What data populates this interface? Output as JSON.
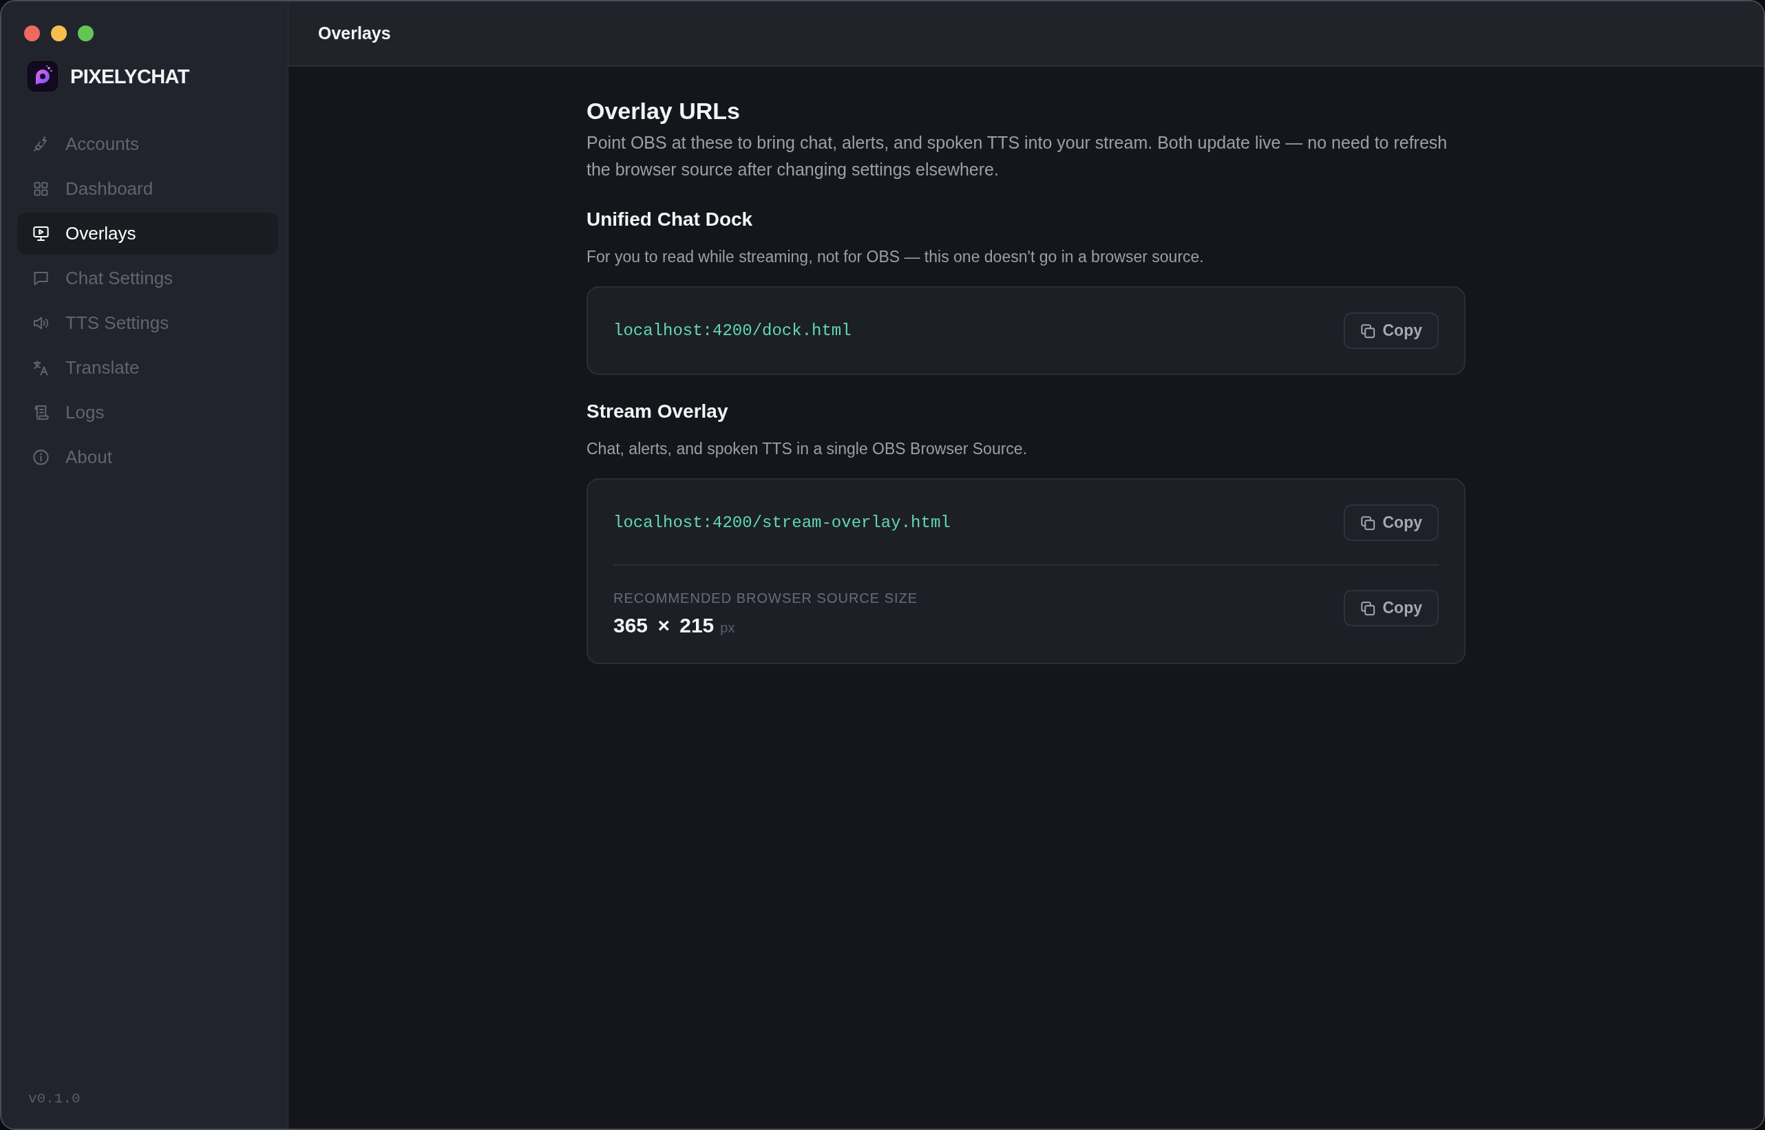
{
  "sidebar": {
    "app_name": "PIXELYCHAT",
    "items": [
      {
        "label": "Accounts",
        "selected": false
      },
      {
        "label": "Dashboard",
        "selected": false
      },
      {
        "label": "Overlays",
        "selected": true
      },
      {
        "label": "Chat Settings",
        "selected": false
      },
      {
        "label": "TTS Settings",
        "selected": false
      },
      {
        "label": "Translate",
        "selected": false
      },
      {
        "label": "Logs",
        "selected": false
      },
      {
        "label": "About",
        "selected": false
      }
    ],
    "version": "v0.1.0"
  },
  "header": {
    "title": "Overlays"
  },
  "page": {
    "title": "Overlay URLs",
    "description": "Point OBS at these to bring chat, alerts, and spoken TTS into your stream. Both update live — no need to refresh the browser source after changing settings elsewhere."
  },
  "sections": [
    {
      "title": "Unified Chat Dock",
      "description": "For you to read while streaming, not for OBS — this one doesn't go in a browser source.",
      "rows": [
        {
          "kind": "url",
          "value": "localhost:4200/dock.html",
          "button": "Copy"
        }
      ]
    },
    {
      "title": "Stream Overlay",
      "description": "Chat, alerts, and spoken TTS in a single OBS Browser Source.",
      "rows": [
        {
          "kind": "url",
          "value": "localhost:4200/stream-overlay.html",
          "button": "Copy"
        },
        {
          "kind": "size",
          "label": "RECOMMENDED BROWSER SOURCE SIZE",
          "value": "365 × 215",
          "unit": "px",
          "button": "Copy"
        }
      ]
    }
  ]
}
